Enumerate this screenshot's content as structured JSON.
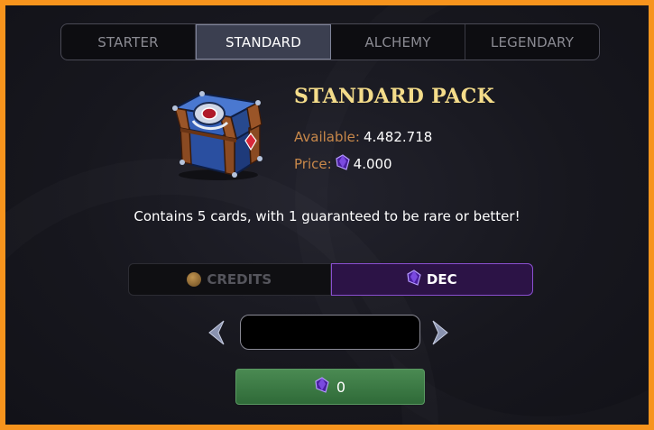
{
  "tabs": [
    {
      "label": "STARTER"
    },
    {
      "label": "STANDARD"
    },
    {
      "label": "ALCHEMY"
    },
    {
      "label": "LEGENDARY"
    }
  ],
  "active_tab": "STANDARD",
  "pack": {
    "title": "STANDARD PACK",
    "available_label": "Available:",
    "available_value": "4.482.718",
    "price_label": "Price:",
    "price_value": "4.000",
    "description": "Contains 5 cards, with 1 guaranteed to be rare or better!",
    "image_icon": "blue-chest-icon"
  },
  "currency": {
    "credits_label": "CREDITS",
    "dec_label": "DEC",
    "selected": "DEC"
  },
  "quantity": {
    "value": ""
  },
  "buy_button": {
    "amount": "0",
    "icon": "dec-gem-icon"
  },
  "colors": {
    "frame": "#f7941d",
    "title": "#f4dc8a",
    "label": "#c8884a",
    "dec_accent": "#8a4fd0",
    "buy_green": "#3f7c47"
  }
}
